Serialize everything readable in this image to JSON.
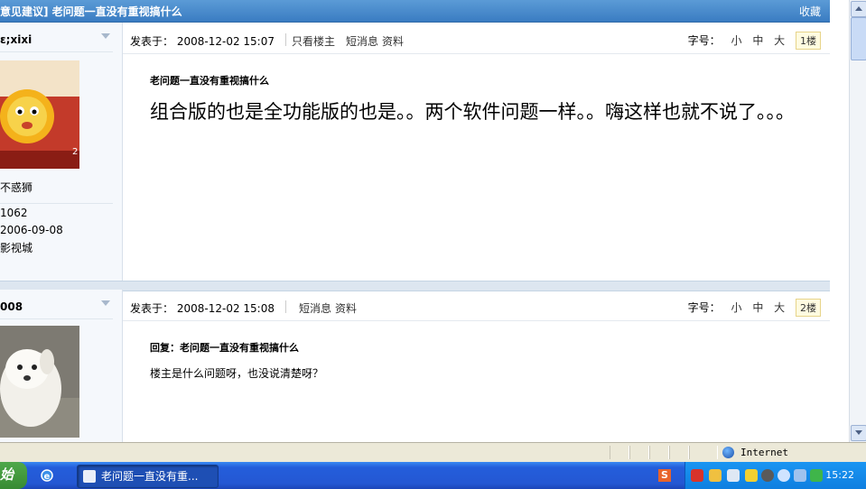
{
  "thread": {
    "title": "意见建议] 老问题一直没有重视搞什么",
    "favorite_label": "收藏"
  },
  "posts": [
    {
      "username": "ε;xixi",
      "avatar_caption": "",
      "user_title": "不惑狮",
      "stat1": "1062",
      "stat2": "2006-09-08",
      "stat3": "影视城",
      "posted_label": "发表于：",
      "posted_time": "2008-12-02 15:07",
      "link_only_op": "只看楼主",
      "link_pm": "短消息",
      "link_profile": "资料",
      "fontsize_label": "字号：",
      "size_small": "小",
      "size_mid": "中",
      "size_large": "大",
      "floor": "1楼",
      "title": "老问题一直没有重视搞什么",
      "body": "组合版的也是全功能版的也是。。两个软件问题一样。。嗨这样也就不说了。。。"
    },
    {
      "username": "008",
      "posted_label": "发表于：",
      "posted_time": "2008-12-02 15:08",
      "link_pm": "短消息",
      "link_profile": "资料",
      "fontsize_label": "字号：",
      "size_small": "小",
      "size_mid": "中",
      "size_large": "大",
      "floor": "2楼",
      "title": "回复：老问题一直没有重视搞什么",
      "body": "楼主是什么问题呀，也没说清楚呀？"
    }
  ],
  "statusbar": {
    "zone": "Internet"
  },
  "taskbar": {
    "start_label": "始",
    "task_label": "老问题一直没有重...",
    "clock": "15:22"
  },
  "colors": {
    "title_bar": "#3a7cc2",
    "taskbar": "#245edb",
    "tray": "#0f7fe0"
  }
}
